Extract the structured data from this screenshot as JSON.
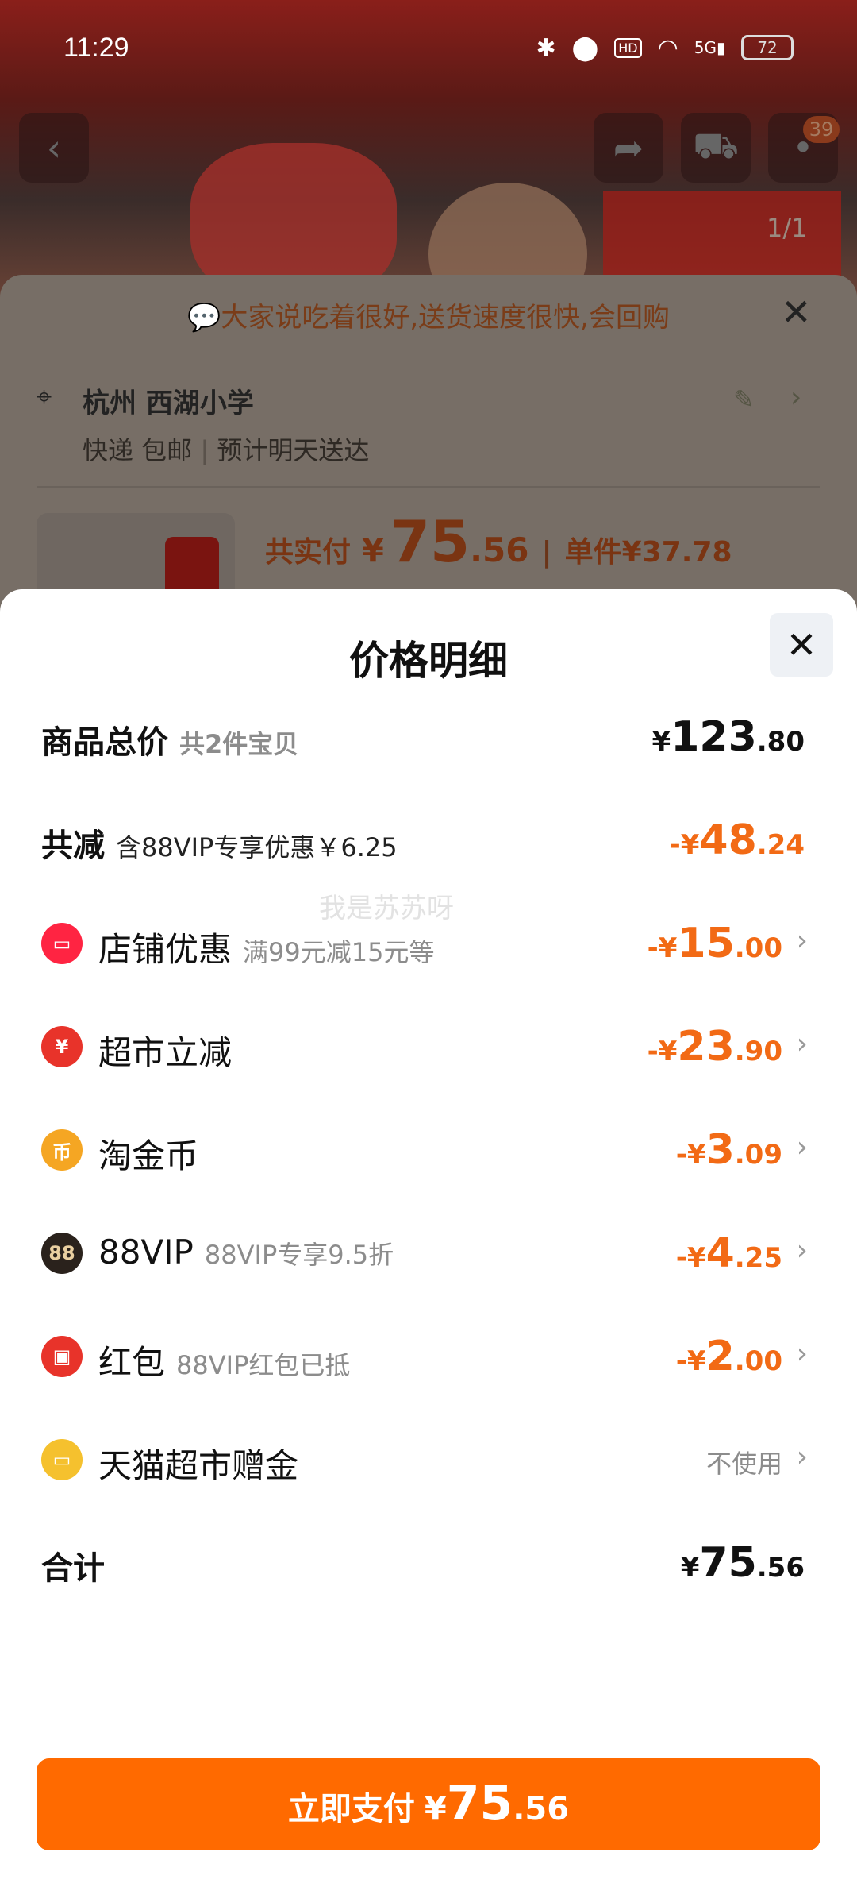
{
  "status_bar": {
    "time": "11:29",
    "battery": "72",
    "network": "5G",
    "hd": "HD",
    "icons": [
      "bluetooth-icon",
      "location-icon",
      "hd-icon",
      "wifi-icon",
      "signal-icon",
      "battery-icon"
    ]
  },
  "background_page": {
    "cart_badge": "39",
    "image_counter": "1/1",
    "review_tip": "大家说吃着很好,送货速度很快,会回购",
    "address": {
      "title": "杭州 西湖小学",
      "shipping": "快递 包邮",
      "eta": "预计明天送达"
    },
    "price": {
      "label": "共实付",
      "yen": "¥",
      "int": "75",
      "dec": ".56",
      "unit_price": "单件¥37.78"
    }
  },
  "sheet": {
    "title": "价格明细",
    "watermark": "我是苏苏呀",
    "rows": [
      {
        "label": "商品总价",
        "sub": "共2件宝贝",
        "yen": "¥",
        "int": "123",
        "dec": ".80"
      },
      {
        "label": "共减",
        "sub": "含88VIP专享优惠￥6.25",
        "yen": "-¥",
        "int": "48",
        "dec": ".24"
      },
      {
        "label": "店铺优惠",
        "sub": "满99元减15元等",
        "yen": "-¥",
        "int": "15",
        "dec": ".00",
        "icon": "shop-icon",
        "icon_color": "#ff2442"
      },
      {
        "label": "超市立减",
        "sub": "",
        "yen": "-¥",
        "int": "23",
        "dec": ".90",
        "icon": "yuan-discount-icon",
        "icon_color": "#e8332a"
      },
      {
        "label": "淘金币",
        "sub": "",
        "yen": "-¥",
        "int": "3",
        "dec": ".09",
        "icon": "coin-icon",
        "icon_color": "#f5a623"
      },
      {
        "label": "88VIP",
        "sub": "88VIP专享9.5折",
        "yen": "-¥",
        "int": "4",
        "dec": ".25",
        "icon": "vip88-icon",
        "icon_color": "#2a221c",
        "icon_text": "88"
      },
      {
        "label": "红包",
        "sub": "88VIP红包已抵",
        "yen": "-¥",
        "int": "2",
        "dec": ".00",
        "icon": "red-packet-icon",
        "icon_color": "#e8332a"
      },
      {
        "label": "天猫超市赠金",
        "sub": "",
        "value": "不使用",
        "icon": "gift-card-icon",
        "icon_color": "#f5c12e"
      },
      {
        "label": "合计",
        "yen": "¥",
        "int": "75",
        "dec": ".56"
      }
    ],
    "pay_button": {
      "label": "立即支付",
      "yen": "¥",
      "int": "75",
      "dec": ".56"
    }
  },
  "colors": {
    "accent_orange": "#f26a15",
    "pay_button": "#ff6a00"
  }
}
